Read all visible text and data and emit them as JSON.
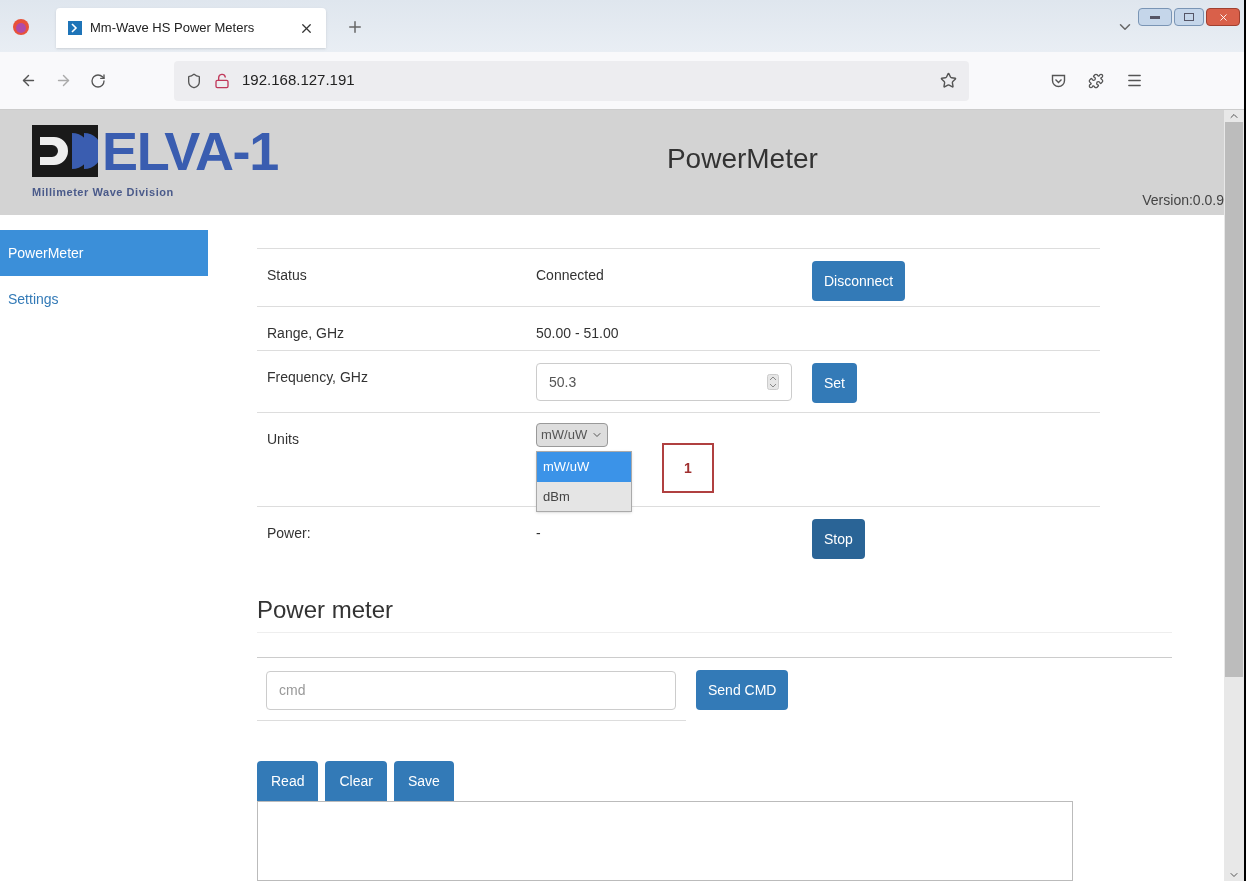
{
  "browser": {
    "tab_title": "Mm-Wave HS Power Meters",
    "address": "192.168.127.191"
  },
  "header": {
    "logo_text": "ELVA-1",
    "logo_subtitle": "Millimeter Wave Division",
    "title": "PowerMeter",
    "version": "Version:0.0.9"
  },
  "sidebar": {
    "items": [
      {
        "label": "PowerMeter",
        "selected": true
      },
      {
        "label": "Settings",
        "selected": false
      }
    ]
  },
  "status_table": {
    "rows": [
      {
        "kind": "text",
        "label": "Status",
        "value": "Connected",
        "button": {
          "label": "Disconnect",
          "active": false
        }
      },
      {
        "kind": "text",
        "label": "Range, GHz",
        "value": "50.00 - 51.00"
      },
      {
        "kind": "number",
        "label": "Frequency, GHz",
        "value": "50.3",
        "button": {
          "label": "Set",
          "active": false
        }
      },
      {
        "kind": "select",
        "label": "Units",
        "value": "mW/uW",
        "expanded": true,
        "options": [
          {
            "label": "mW/uW",
            "selected": true
          },
          {
            "label": "dBm",
            "selected": false
          }
        ],
        "callout": "1"
      },
      {
        "kind": "text",
        "label": "Power:",
        "value": "-",
        "button": {
          "label": "Stop",
          "active": true
        }
      }
    ]
  },
  "power_meter": {
    "heading": "Power meter",
    "cmd_placeholder": "cmd",
    "send_button": "Send CMD",
    "buttons": [
      "Read",
      "Clear",
      "Save"
    ]
  }
}
